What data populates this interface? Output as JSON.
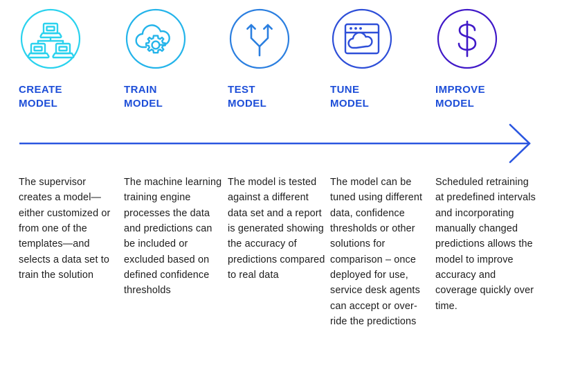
{
  "diagram": {
    "type": "process-flow",
    "orientation": "left-to-right",
    "arrow": {
      "name": "process-flow-arrow",
      "color": "#2a56e0",
      "direction": "right",
      "style": "line-with-open-chevron-head"
    },
    "heading_color": "#1d4ed8",
    "body_color": "#1c1c1c",
    "steps": [
      {
        "id": "create-model",
        "icon": "three-connected-computers-icon",
        "icon_color": "#2ad2ee",
        "title": "CREATE\nMODEL",
        "body": "The supervisor creates a model—either customized or from one of the templates—and selects a data set to train the solution"
      },
      {
        "id": "train-model",
        "icon": "cloud-with-gear-icon",
        "icon_color": "#24b4ea",
        "title": "TRAIN\nMODEL",
        "body": "The machine learning training engine processes the data and predictions can be included or excluded based on defined confidence thresholds"
      },
      {
        "id": "test-model",
        "icon": "split-path-arrows-icon",
        "icon_color": "#2b7fe0",
        "title": "TEST\nMODEL",
        "body": "The model is tested against a different data set and a report is generated showing the accuracy of predictions compared to real data"
      },
      {
        "id": "tune-model",
        "icon": "browser-window-with-cloud-icon",
        "icon_color": "#2e4fd8",
        "title": "TUNE\nMODEL",
        "body": "The model can be tuned using different data, confidence thresholds or other solutions for comparison – once deployed for use, service desk agents can accept or over-ride the predictions"
      },
      {
        "id": "improve-model",
        "icon": "dollar-sign-icon",
        "icon_color": "#4019c8",
        "title": "IMPROVE\nMODEL",
        "body": "Scheduled retraining at predefined intervals and incorporating manually changed predictions allows the model to improve accuracy and coverage quickly over time."
      }
    ]
  }
}
